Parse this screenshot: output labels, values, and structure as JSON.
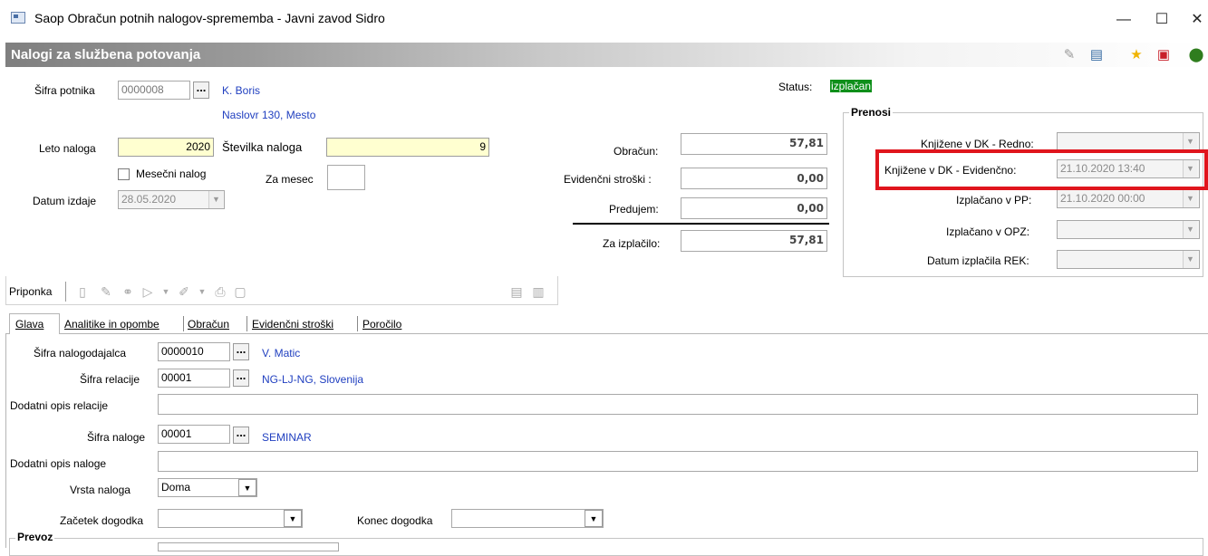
{
  "window": {
    "title": "Saop Obračun potnih nalogov-sprememba - Javni zavod Sidro",
    "minimize": "—",
    "maximize": "☐",
    "close": "✕"
  },
  "header": {
    "title": "Nalogi za službena potovanja"
  },
  "potnik": {
    "label": "Šifra potnika",
    "value": "0000008",
    "dots": "...",
    "name": "K. Boris",
    "address": "Naslovr 130, Mesto"
  },
  "leto": {
    "label": "Leto naloga",
    "value": "2020"
  },
  "stevilka": {
    "label": "Številka naloga",
    "value": "9"
  },
  "mesecni": {
    "label": "Mesečni nalog"
  },
  "zamesec": {
    "label": "Za mesec",
    "value": ""
  },
  "datum_izdaje": {
    "label": "Datum izdaje",
    "value": "28.05.2020"
  },
  "totals": {
    "obracun_label": "Obračun:",
    "obracun_value": "57,81",
    "evidencni_label": "Evidenčni stroški :",
    "evidencni_value": "0,00",
    "predujem_label": "Predujem:",
    "predujem_value": "0,00",
    "izplacilo_label": "Za izplačilo:",
    "izplacilo_value": "57,81"
  },
  "status": {
    "label": "Status:",
    "value": "izplačan",
    "color": "#0e8f1a"
  },
  "prenosi": {
    "legend": "Prenosi",
    "rows": [
      {
        "label": "Knjižene v DK - Redno:",
        "value": ""
      },
      {
        "label": "Knjižene v DK - Evidenčno:",
        "value": "21.10.2020 13:40"
      },
      {
        "label": "Izplačano v PP:",
        "value": "21.10.2020 00:00"
      },
      {
        "label": "Izplačano v OPZ:",
        "value": ""
      },
      {
        "label": "Datum izplačila REK:",
        "value": ""
      }
    ]
  },
  "priponka": {
    "label": "Priponka"
  },
  "tabs": [
    "Glava",
    "Analitike in opombe",
    "Obračun",
    "Evidenčni stroški",
    "Poročilo"
  ],
  "glava": {
    "nalogodajalec": {
      "label": "Šifra nalogodajalca",
      "value": "0000010",
      "name": "V. Matic"
    },
    "relacija": {
      "label": "Šifra relacije",
      "value": "00001",
      "name": "NG-LJ-NG, Slovenija"
    },
    "dodatni_relacije": {
      "label": "Dodatni opis relacije",
      "value": ""
    },
    "naloge": {
      "label": "Šifra naloge",
      "value": "00001",
      "name": "SEMINAR"
    },
    "dodatni_naloge": {
      "label": "Dodatni opis naloge",
      "value": ""
    },
    "vrsta": {
      "label": "Vrsta naloga",
      "value": "Doma"
    },
    "zacetek": {
      "label": "Začetek dogodka",
      "value": ""
    },
    "konec": {
      "label": "Konec dogodka",
      "value": ""
    }
  },
  "prevoz": {
    "legend": "Prevoz"
  },
  "icons": {
    "header": [
      "edit-icon",
      "report-icon",
      "star-icon",
      "pdf-icon",
      "exit-icon"
    ],
    "toolbar": [
      "new-doc-icon",
      "edit-doc-icon",
      "link-icon",
      "doc-arrow-icon",
      "doc-pen-icon",
      "scan-icon",
      "lock-icon",
      "import-icon",
      "export-icon"
    ]
  },
  "colors": {
    "highlight": "#e0151d",
    "link": "#2140c0",
    "yellow_field": "#ffffd0"
  }
}
